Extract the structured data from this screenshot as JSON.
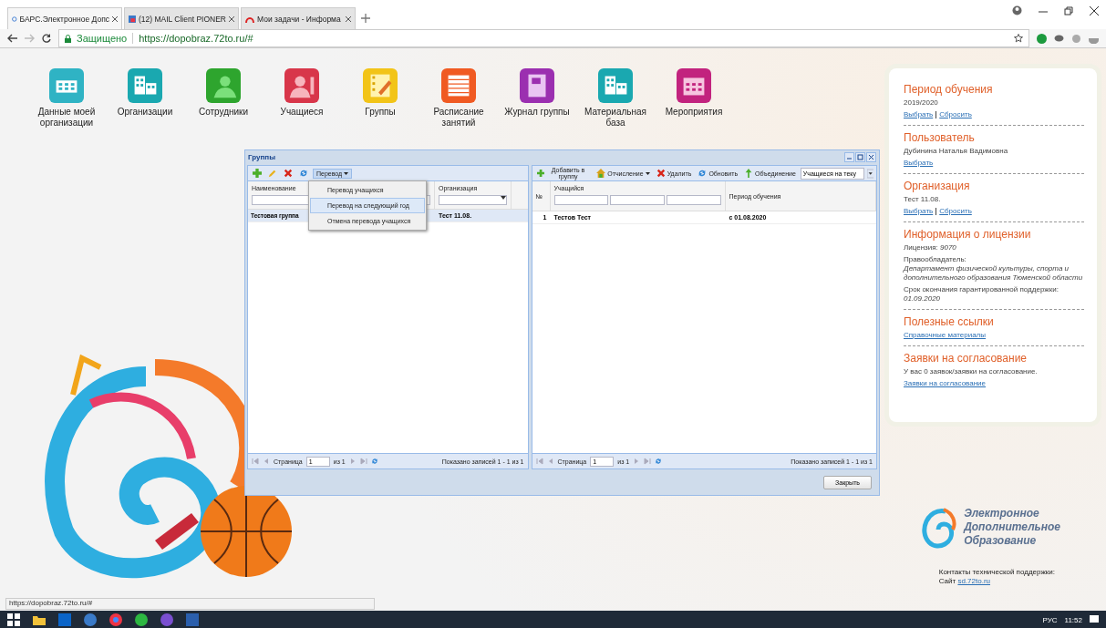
{
  "browser": {
    "tabs": [
      {
        "title": "БАРС.Электронное Допс",
        "kind": "bars",
        "selected": true
      },
      {
        "title": "(12) MAIL Client PIONER",
        "kind": "mail",
        "selected": false
      },
      {
        "title": "Мои задачи - Информа",
        "kind": "arc",
        "selected": false
      }
    ],
    "secure_label": "Защищено",
    "url": "https://dopobraz.72to.ru/#"
  },
  "modules": [
    {
      "label": "Данные моей организации",
      "kind": "building",
      "color": "#2fb3c4"
    },
    {
      "label": "Организации",
      "kind": "buildings",
      "color": "#1aa8b0"
    },
    {
      "label": "Сотрудники",
      "kind": "person",
      "color": "#2ea52e"
    },
    {
      "label": "Учащиеся",
      "kind": "student",
      "color": "#d8364a"
    },
    {
      "label": "Группы",
      "kind": "film",
      "color": "#f2c418"
    },
    {
      "label": "Расписание занятий",
      "kind": "list",
      "color": "#f05a22"
    },
    {
      "label": "Журнал группы",
      "kind": "notebook",
      "color": "#9b2fb0"
    },
    {
      "label": "Материальная база",
      "kind": "buildings",
      "color": "#1aa8b0"
    },
    {
      "label": "Мероприятия",
      "kind": "calendar",
      "color": "#c2237e"
    }
  ],
  "dialog": {
    "title": "Группы",
    "left": {
      "menu_button": "Перевод",
      "menu": [
        {
          "label": "Перевод учащихся",
          "selected": false
        },
        {
          "label": "Перевод на следующий год",
          "selected": true
        },
        {
          "label": "Отмена перевода учащихся",
          "selected": false
        }
      ],
      "columns": [
        "Наименование",
        "Организация"
      ],
      "rows": [
        {
          "cells": [
            "Тестовая группа",
            "Тест 11.08."
          ],
          "selected": true
        }
      ],
      "pager": {
        "page_label": "Страница",
        "page": "1",
        "of": "из 1",
        "summary": "Показано записей 1 - 1 из 1"
      }
    },
    "right": {
      "toolbar": [
        {
          "label": "Добавить в группу",
          "kind": "add",
          "caret": false
        },
        {
          "label": "Отчисление",
          "kind": "house",
          "caret": true
        },
        {
          "label": "Удалить",
          "kind": "delete",
          "caret": false
        },
        {
          "label": "Обновить",
          "kind": "refresh",
          "caret": false
        },
        {
          "label": "Объединение",
          "kind": "merge",
          "caret": false
        }
      ],
      "filter": "Учащиеся на теку",
      "columns": [
        "№",
        "Учащийся",
        "Период обучения"
      ],
      "rows": [
        {
          "cells": [
            "1",
            "Тестов Тест",
            "с 01.08.2020"
          ],
          "selected": false
        }
      ],
      "pager": {
        "page_label": "Страница",
        "page": "1",
        "of": "из 1",
        "summary": "Показано записей 1 - 1 из 1"
      }
    },
    "close_button": "Закрыть"
  },
  "side_panel": [
    {
      "title": "Период обучения",
      "lines": [
        {
          "kind": "text",
          "text": "2019/2020"
        },
        {
          "kind": "links",
          "links": [
            "Выбрать",
            "Сбросить"
          ]
        }
      ]
    },
    {
      "title": "Пользователь",
      "lines": [
        {
          "kind": "text",
          "text": "Дубинина Наталья Вадимовна"
        },
        {
          "kind": "links",
          "links": [
            "Выбрать"
          ]
        }
      ]
    },
    {
      "title": "Организация",
      "lines": [
        {
          "kind": "text",
          "text": "Тест 11.08."
        },
        {
          "kind": "links",
          "links": [
            "Выбрать",
            "Сбросить"
          ]
        }
      ]
    },
    {
      "title": "Информация о лицензии",
      "lines": [
        {
          "kind": "text",
          "text": "Лицензия: *9070*"
        },
        {
          "kind": "text",
          "text": "Правообладатель:"
        },
        {
          "kind": "italic",
          "text": "Департамент физической культуры, спорта и дополнительного образования Тюменской области"
        },
        {
          "kind": "text",
          "text": "Срок окончания гарантированной поддержки:"
        },
        {
          "kind": "italic",
          "text": "01.09.2020"
        }
      ]
    },
    {
      "title": "Полезные ссылки",
      "lines": [
        {
          "kind": "links",
          "links": [
            "Справочные материалы"
          ]
        }
      ]
    },
    {
      "title": "Заявки на согласование",
      "lines": [
        {
          "kind": "text",
          "text": "У вас 0 заявок/заявки на согласование."
        },
        {
          "kind": "links",
          "links": [
            "Заявки на согласование"
          ]
        }
      ]
    }
  ],
  "brand": [
    "Электронное",
    "Дополнительное",
    "Образование"
  ],
  "support": {
    "title": "Контакты технической поддержки:",
    "site_label": "Сайт",
    "site_link": "sd.72to.ru"
  },
  "status_url": "https://dopobraz.72to.ru/#",
  "taskbar": {
    "language": "РУС",
    "time": "11:52"
  }
}
